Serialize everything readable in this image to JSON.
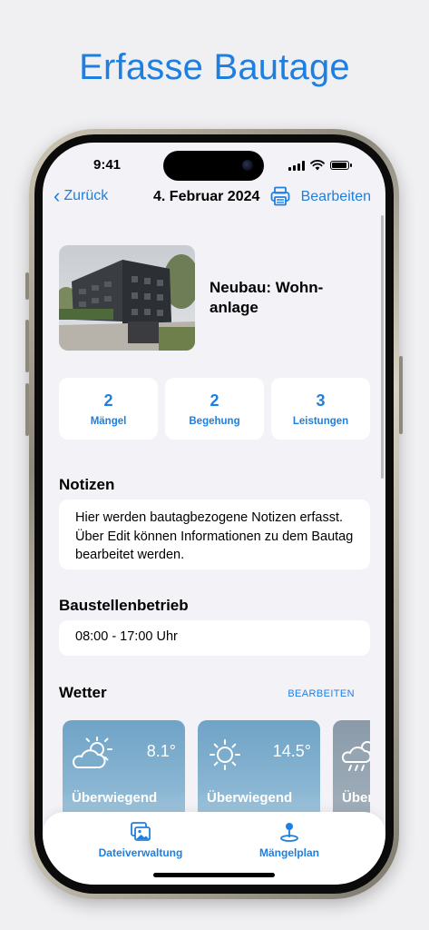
{
  "headline": "Erfasse Bautage",
  "status_bar": {
    "time": "9:41"
  },
  "nav": {
    "back_label": "Zurück",
    "title": "4. Februar 2024",
    "edit_label": "Bearbeiten",
    "print_icon": "printer-icon"
  },
  "project": {
    "title": "Neubau: Wohn-anlage"
  },
  "stats": [
    {
      "value": "2",
      "label": "Mängel"
    },
    {
      "value": "2",
      "label": "Begehung"
    },
    {
      "value": "3",
      "label": "Leistungen"
    }
  ],
  "notes": {
    "title": "Notizen",
    "text": "Hier werden bautagbezogene Notizen erfasst. Über Edit können Informationen zu dem Bautag bearbeitet werden."
  },
  "site_operation": {
    "title": "Baustellenbetrieb",
    "hours": "08:00 - 17:00 Uhr"
  },
  "weather": {
    "title": "Wetter",
    "edit_label": "BEARBEITEN",
    "cards": [
      {
        "icon": "partly-sunny-icon",
        "temp": "8.1°",
        "condition": "Überwiegend"
      },
      {
        "icon": "sun-icon",
        "temp": "14.5°",
        "condition": "Überwiegend"
      },
      {
        "icon": "rain-sun-icon",
        "temp": "",
        "condition": "Über"
      }
    ]
  },
  "tabs": [
    {
      "label": "Dateiverwaltung",
      "icon": "photo-gallery-icon"
    },
    {
      "label": "Mängelplan",
      "icon": "map-pin-icon"
    }
  ],
  "colors": {
    "accent": "#1f7fe0",
    "background": "#f2f2f7",
    "weather_card": "#7aaccc"
  }
}
